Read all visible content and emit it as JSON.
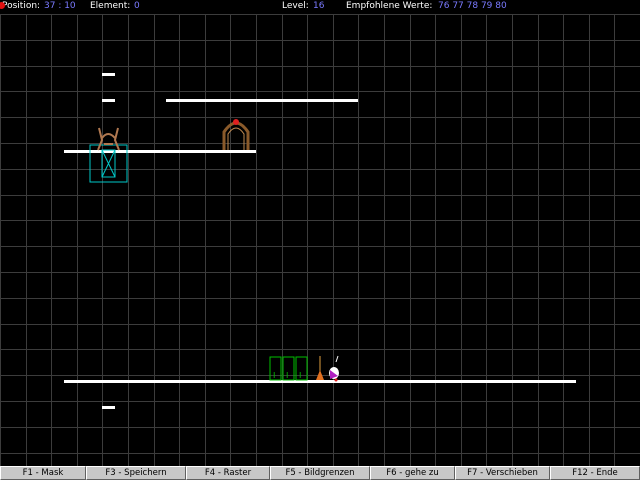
{
  "header": {
    "position_label": "Position:",
    "position_value": "37 : 10",
    "element_label": "Element:",
    "element_value": "0",
    "level_label": "Level:",
    "level_value": "16",
    "recommended_label": "Empfohlene Werte:",
    "recommended_value": "76 77 78 79 80"
  },
  "colors": {
    "background": "#000000",
    "grid": "#3c3c3c",
    "value_text": "#7a7aff",
    "platform": "#ffffff",
    "selection": "#00c8c8",
    "crate": "#00c000"
  },
  "grid": {
    "columns": 25,
    "rows": 18,
    "cell_width": 25.6,
    "cell_height": 25.8
  },
  "footer": {
    "keys": [
      {
        "label": "F1 - Mask"
      },
      {
        "label": "F3 - Speichern"
      },
      {
        "label": "F4 - Raster"
      },
      {
        "label": "F5 - Bildgrenzen"
      },
      {
        "label": "F6 - gehe zu"
      },
      {
        "label": "F7 - Verschieben"
      },
      {
        "label": "F12 - Ende"
      }
    ]
  },
  "sprites": [
    {
      "name": "bat-creature-icon"
    },
    {
      "name": "thorny-door-icon"
    },
    {
      "name": "crate-icon",
      "glyph": "I"
    },
    {
      "name": "crate-icon",
      "glyph": "I"
    },
    {
      "name": "crate-icon",
      "glyph": "I"
    },
    {
      "name": "player-character-icon"
    }
  ]
}
